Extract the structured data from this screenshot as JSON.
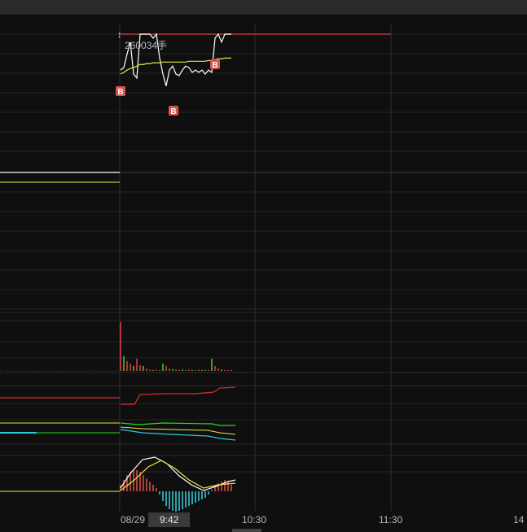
{
  "chart_data": {
    "type": "line",
    "colors": {
      "price": "#ffffff",
      "avg": "#e8e84a",
      "buy_marker": "#d9534f",
      "vol_up": "#e34040",
      "vol_down": "#3fcf3f",
      "ind_red": "#e02a2a",
      "ind_green": "#22dd22",
      "ind_cyan": "#2ec8d8",
      "macd_pos": "#e0504a",
      "macd_neg": "#3ad0e0"
    },
    "x_axis": {
      "date_label": "08/29",
      "cursor_time": "9:42",
      "ticks": [
        "10:30",
        "11:30",
        "14"
      ]
    },
    "volume_label": "260034手",
    "buy_marker_label": "B",
    "series": [
      {
        "values": [
          0.55,
          0.58,
          0.75,
          0.9,
          0.5,
          0.45,
          1,
          1,
          1,
          1,
          0.95,
          1,
          0.7,
          0.5,
          0.35,
          0.55,
          0.6,
          0.5,
          0.48,
          0.55,
          0.6,
          0.58,
          0.52,
          0.55,
          0.52,
          0.55,
          0.5,
          0.55,
          0.52,
          0.95,
          1,
          0.9,
          1,
          1,
          1
        ]
      },
      {
        "values": [
          0.5,
          0.52,
          0.55,
          0.57,
          0.58,
          0.6,
          0.62,
          0.62,
          0.63,
          0.63,
          0.64,
          0.64,
          0.64,
          0.65,
          0.65,
          0.65,
          0.65,
          0.65,
          0.65,
          0.65,
          0.65,
          0.66,
          0.66,
          0.66,
          0.66,
          0.66,
          0.66,
          0.67,
          0.67,
          0.68,
          0.69,
          0.69,
          0.7,
          0.7,
          0.7
        ]
      }
    ],
    "volume_values": [
      1,
      0.3,
      0.2,
      0.15,
      0.1,
      0.25,
      0.12,
      0.1,
      0.05,
      0.03,
      0.02,
      0.03,
      0.02,
      0.15,
      0.1,
      0.05,
      0.04,
      0.03,
      0.02,
      0.03,
      0.02,
      0.03,
      0.02,
      0.02,
      0.03,
      0.02,
      0.03,
      0.02,
      0.25,
      0.1,
      0.05,
      0.03,
      0.02,
      0.02,
      0.02
    ],
    "macd_hist": [
      0.2,
      0.35,
      0.5,
      0.6,
      0.65,
      0.65,
      0.6,
      0.5,
      0.4,
      0.3,
      0.2,
      0.1,
      -0.1,
      -0.3,
      -0.45,
      -0.55,
      -0.6,
      -0.62,
      -0.6,
      -0.55,
      -0.5,
      -0.45,
      -0.4,
      -0.35,
      -0.3,
      -0.25,
      -0.2,
      -0.1,
      0.05,
      0.15,
      0.25,
      0.3,
      0.35,
      0.3,
      0.2
    ]
  }
}
